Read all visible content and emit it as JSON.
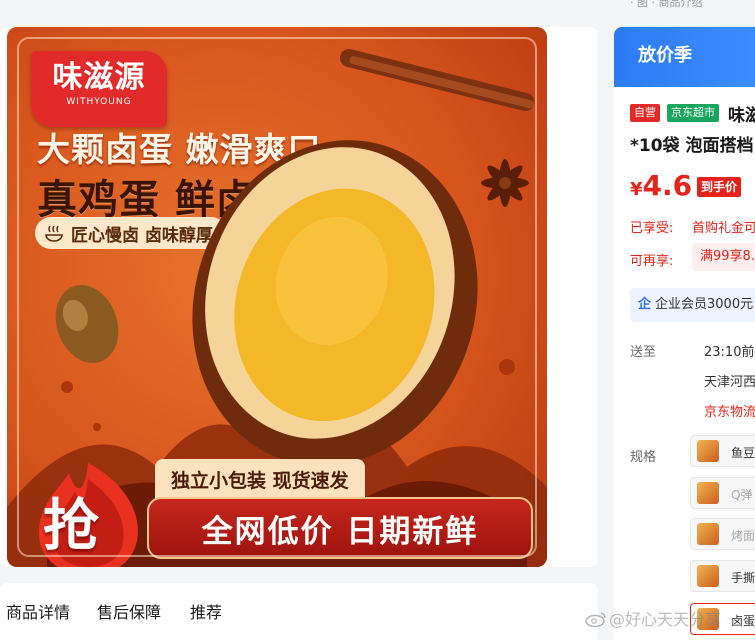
{
  "top_strip": {
    "text": "· 图 · 商品介绍"
  },
  "product_image": {
    "brand": {
      "name_cn": "味滋源",
      "name_en": "WITHYOUNG"
    },
    "headline_1": "大颗卤蛋 嫩滑爽口",
    "headline_2": "真鸡蛋 鲜卤制",
    "sub_pill": "匠心慢卤 卤味醇厚",
    "grab_badge": "抢",
    "promo_top": "独立小包装 现货速发",
    "promo_bottom": "全网低价 日期新鲜"
  },
  "tabs": [
    {
      "label": "商品详情"
    },
    {
      "label": "售后保障"
    },
    {
      "label": "推荐"
    }
  ],
  "side_panel": {
    "season_banner": "放价季",
    "badge_self": "自营",
    "badge_jd": "京东超市",
    "title_fragment": "味滋",
    "title_line2": "*10袋 泡面搭档",
    "price": {
      "yen": "¥",
      "value": "4.6",
      "tag": "到手价"
    },
    "enjoyed_label": "已享受:",
    "enjoyed_value": "首购礼金可",
    "more_label": "可再享:",
    "more_value": "满99享8.",
    "enterprise": {
      "icon": "企",
      "text": "企业会员3000元"
    },
    "ship_label": "送至",
    "delivery_time": "23:10前",
    "delivery_location": "天津河西",
    "logistics": "京东物流",
    "spec_label": "规格",
    "specs": [
      {
        "label": "鱼豆",
        "state": "normal"
      },
      {
        "label": "Q弹",
        "state": "dim"
      },
      {
        "label": "烤面",
        "state": "dim"
      },
      {
        "label": "手撕",
        "state": "normal"
      },
      {
        "label": "卤蛋",
        "state": "selected"
      }
    ]
  },
  "watermark": "@好心天天分享",
  "colors": {
    "brand_red": "#e4231c",
    "banner_blue": "#2d7bf3",
    "jd_green": "#18a55c",
    "egg_orange": "#d8561d"
  }
}
